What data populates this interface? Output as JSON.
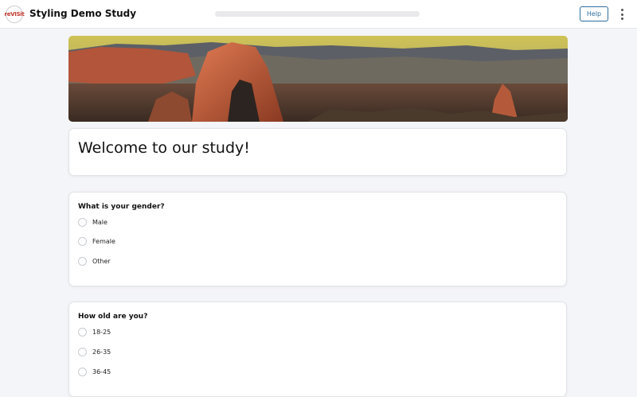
{
  "header": {
    "logo_text": "reVISit",
    "title": "Styling Demo Study",
    "progress": 0,
    "help_label": "Help",
    "menu_icon": "kebab-menu-icon"
  },
  "banner": {
    "description": "landscape-banner-image"
  },
  "welcome": {
    "title": "Welcome to our study!"
  },
  "questions": [
    {
      "prompt": "What is your gender?",
      "options": [
        "Male",
        "Female",
        "Other"
      ]
    },
    {
      "prompt": "How old are you?",
      "options": [
        "18-25",
        "26-35",
        "36-45"
      ]
    }
  ],
  "colors": {
    "accent": "#2e6e9e",
    "background": "#f4f5f8"
  }
}
